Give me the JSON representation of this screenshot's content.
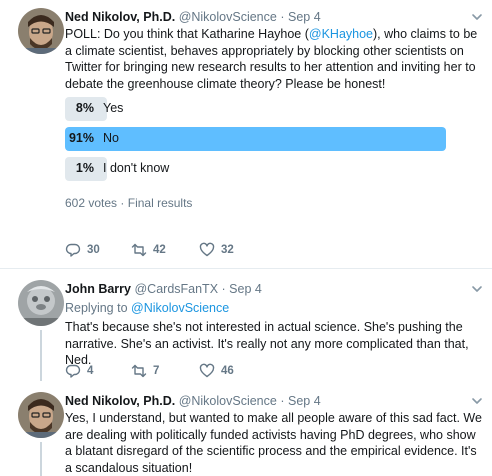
{
  "tweets": [
    {
      "name": "Ned Nikolov, Ph.D.",
      "handle": "@NikolovScience",
      "date": "Sep 4",
      "text_before": "POLL: Do you think that Katharine Hayhoe (",
      "mention": "@KHayhoe",
      "text_after": "), who claims to be a climate scientist, behaves appropriately by blocking other scientists on Twitter for bringing new research results to her attention and inviting her to debate the greenhouse climate theory? Please be honest!",
      "poll": {
        "options": [
          {
            "pct": "8%",
            "label": "Yes",
            "value": 8,
            "winner": false
          },
          {
            "pct": "91%",
            "label": "No",
            "value": 91,
            "winner": true
          },
          {
            "pct": "1%",
            "label": "I don't know",
            "value": 1,
            "winner": false
          }
        ],
        "votes": "602 votes",
        "status": "Final results"
      },
      "replies": "30",
      "retweets": "42",
      "likes": "32"
    },
    {
      "name": "John Barry",
      "handle": "@CardsFanTX",
      "date": "Sep 4",
      "replying_prefix": "Replying to",
      "replying_to": "@NikolovScience",
      "text": "That's because she's not interested in actual science. She's pushing the narrative. She's an activist. It's really not any more complicated than that, Ned.",
      "replies": "4",
      "retweets": "7",
      "likes": "46"
    },
    {
      "name": "Ned Nikolov, Ph.D.",
      "handle": "@NikolovScience",
      "date": "Sep 4",
      "text": "Yes, I understand, but wanted to make all people aware of this sad fact. We are dealing with politically funded activists having PhD degrees, who show a blatant disregard of the scientific process and the empirical evidence. It's a scandalous situation!"
    }
  ],
  "separator": "·",
  "colors": {
    "accent": "#1b95e0",
    "poll_winner": "#5fbeff",
    "poll_other": "#e1e8ed",
    "muted": "#657786"
  }
}
